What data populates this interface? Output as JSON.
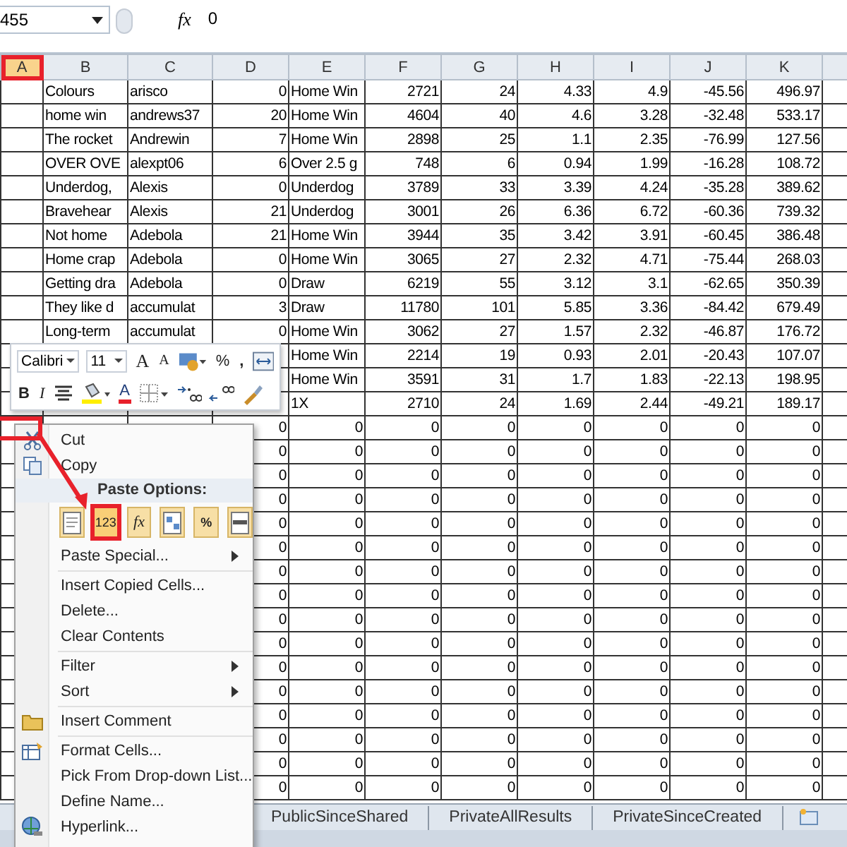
{
  "formula_bar": {
    "name_box": "455",
    "fx": "fx",
    "value": "0"
  },
  "columns": [
    {
      "label": "A",
      "selected": true
    },
    {
      "label": "B",
      "kind": "text",
      "selected": false
    },
    {
      "label": "C",
      "kind": "text",
      "selected": false
    },
    {
      "label": "D",
      "kind": "number",
      "selected": false
    },
    {
      "label": "E",
      "kind": "text",
      "selected": false
    },
    {
      "label": "F",
      "kind": "number",
      "selected": false
    },
    {
      "label": "G",
      "kind": "number",
      "selected": false
    },
    {
      "label": "H",
      "kind": "number",
      "selected": false
    },
    {
      "label": "I",
      "kind": "number",
      "selected": false
    },
    {
      "label": "J",
      "kind": "number",
      "selected": false
    },
    {
      "label": "K",
      "kind": "number",
      "selected": false
    }
  ],
  "rows": [
    {
      "kind": "data",
      "cells": [
        null,
        "Colours",
        "arisco",
        "0",
        "Home Win",
        "2721",
        "24",
        "4.33",
        "4.9",
        "-45.56",
        "496.97"
      ]
    },
    {
      "kind": "data",
      "cells": [
        null,
        "home win",
        "andrews37",
        "20",
        "Home Win",
        "4604",
        "40",
        "4.6",
        "3.28",
        "-32.48",
        "533.17"
      ]
    },
    {
      "kind": "data",
      "cells": [
        null,
        "The rocket",
        "Andrewin",
        "7",
        "Home Win",
        "2898",
        "25",
        "1.1",
        "2.35",
        "-76.99",
        "127.56"
      ]
    },
    {
      "kind": "data",
      "cells": [
        null,
        "OVER OVE",
        "alexpt06",
        "6",
        "Over 2.5 g",
        "748",
        "6",
        "0.94",
        "1.99",
        "-16.28",
        "108.72"
      ]
    },
    {
      "kind": "data",
      "cells": [
        null,
        "Underdog,",
        "Alexis",
        "0",
        "Underdog",
        "3789",
        "33",
        "3.39",
        "4.24",
        "-35.28",
        "389.62"
      ]
    },
    {
      "kind": "data",
      "cells": [
        null,
        "Bravehear",
        "Alexis",
        "21",
        "Underdog",
        "3001",
        "26",
        "6.36",
        "6.72",
        "-60.36",
        "739.32"
      ]
    },
    {
      "kind": "data",
      "cells": [
        null,
        "Not home",
        "Adebola",
        "21",
        "Home Win",
        "3944",
        "35",
        "3.42",
        "3.91",
        "-60.45",
        "386.48"
      ]
    },
    {
      "kind": "data",
      "cells": [
        null,
        "Home crap",
        "Adebola",
        "0",
        "Home Win",
        "3065",
        "27",
        "2.32",
        "4.71",
        "-75.44",
        "268.03"
      ]
    },
    {
      "kind": "data",
      "cells": [
        null,
        "Getting dra",
        "Adebola",
        "0",
        "Draw",
        "6219",
        "55",
        "3.12",
        "3.1",
        "-62.65",
        "350.39"
      ]
    },
    {
      "kind": "data",
      "cells": [
        null,
        "They like d",
        "accumulat",
        "3",
        "Draw",
        "11780",
        "101",
        "5.85",
        "3.36",
        "-84.42",
        "679.49"
      ]
    },
    {
      "kind": "data",
      "cells": [
        null,
        "Long-term",
        "accumulat",
        "0",
        "Home Win",
        "3062",
        "27",
        "1.57",
        "2.32",
        "-46.87",
        "176.72"
      ]
    },
    {
      "kind": "data",
      "cells": [
        null,
        null,
        null,
        null,
        "Home Win",
        "2214",
        "19",
        "0.93",
        "2.01",
        "-20.43",
        "107.07"
      ]
    },
    {
      "kind": "data",
      "cells": [
        null,
        null,
        null,
        null,
        "Home Win",
        "3591",
        "31",
        "1.7",
        "1.83",
        "-22.13",
        "198.95"
      ]
    },
    {
      "kind": "data",
      "cells": [
        null,
        null,
        null,
        null,
        "1X",
        "2710",
        "24",
        "1.69",
        "2.44",
        "-49.21",
        "189.17"
      ]
    },
    {
      "kind": "filler",
      "cells": [
        null,
        null,
        null,
        "0",
        "0",
        "0",
        "0",
        "0",
        "0",
        "0",
        "0"
      ]
    },
    {
      "kind": "filler",
      "cells": [
        null,
        null,
        null,
        "0",
        "0",
        "0",
        "0",
        "0",
        "0",
        "0",
        "0"
      ]
    },
    {
      "kind": "filler",
      "cells": [
        null,
        null,
        null,
        "0",
        "0",
        "0",
        "0",
        "0",
        "0",
        "0",
        "0"
      ]
    },
    {
      "kind": "filler",
      "cells": [
        null,
        null,
        null,
        "0",
        "0",
        "0",
        "0",
        "0",
        "0",
        "0",
        "0"
      ]
    },
    {
      "kind": "filler",
      "cells": [
        null,
        null,
        null,
        "0",
        "0",
        "0",
        "0",
        "0",
        "0",
        "0",
        "0"
      ]
    },
    {
      "kind": "filler",
      "cells": [
        null,
        null,
        null,
        "0",
        "0",
        "0",
        "0",
        "0",
        "0",
        "0",
        "0"
      ]
    },
    {
      "kind": "filler",
      "cells": [
        null,
        null,
        null,
        "0",
        "0",
        "0",
        "0",
        "0",
        "0",
        "0",
        "0"
      ]
    },
    {
      "kind": "filler",
      "cells": [
        null,
        null,
        null,
        "0",
        "0",
        "0",
        "0",
        "0",
        "0",
        "0",
        "0"
      ]
    },
    {
      "kind": "filler",
      "cells": [
        null,
        null,
        null,
        "0",
        "0",
        "0",
        "0",
        "0",
        "0",
        "0",
        "0"
      ]
    },
    {
      "kind": "filler",
      "cells": [
        null,
        null,
        null,
        "0",
        "0",
        "0",
        "0",
        "0",
        "0",
        "0",
        "0"
      ]
    },
    {
      "kind": "filler",
      "cells": [
        null,
        null,
        null,
        "0",
        "0",
        "0",
        "0",
        "0",
        "0",
        "0",
        "0"
      ]
    },
    {
      "kind": "filler",
      "cells": [
        null,
        null,
        null,
        "0",
        "0",
        "0",
        "0",
        "0",
        "0",
        "0",
        "0"
      ]
    },
    {
      "kind": "filler",
      "cells": [
        null,
        null,
        null,
        "0",
        "0",
        "0",
        "0",
        "0",
        "0",
        "0",
        "0"
      ]
    },
    {
      "kind": "filler",
      "cells": [
        null,
        null,
        null,
        "0",
        "0",
        "0",
        "0",
        "0",
        "0",
        "0",
        "0"
      ]
    },
    {
      "kind": "filler",
      "cells": [
        null,
        null,
        null,
        "0",
        "0",
        "0",
        "0",
        "0",
        "0",
        "0",
        "0"
      ]
    },
    {
      "kind": "filler",
      "cells": [
        null,
        null,
        null,
        "0",
        "0",
        "0",
        "0",
        "0",
        "0",
        "0",
        "0"
      ]
    }
  ],
  "mini_toolbar": {
    "font": "Calibri",
    "size": "11",
    "grow_font": "A",
    "shrink_font": "A",
    "percent": "%",
    "comma": ",",
    "bold": "B",
    "italic": "I",
    "font_color": "A"
  },
  "context_menu": [
    {
      "kind": "cut",
      "label": "Cut"
    },
    {
      "kind": "copy",
      "label": "Copy"
    },
    {
      "kind": "heading",
      "label": "Paste Options:"
    },
    {
      "kind": "paste_row",
      "options": [
        {
          "kind": "paste",
          "selected": false
        },
        {
          "kind": "values",
          "label": "123",
          "selected": true
        },
        {
          "kind": "formulas",
          "label": "fx",
          "selected": false
        },
        {
          "kind": "transpose",
          "selected": false
        },
        {
          "kind": "formatting",
          "label": "%",
          "selected": false
        },
        {
          "kind": "link",
          "selected": false
        }
      ]
    },
    {
      "kind": "submenu",
      "label": "Paste Special..."
    },
    {
      "kind": "separator"
    },
    {
      "kind": "command",
      "label": "Insert Copied Cells..."
    },
    {
      "kind": "command",
      "label": "Delete..."
    },
    {
      "kind": "command",
      "label": "Clear Contents"
    },
    {
      "kind": "separator"
    },
    {
      "kind": "submenu",
      "label": "Filter"
    },
    {
      "kind": "submenu",
      "label": "Sort"
    },
    {
      "kind": "separator"
    },
    {
      "kind": "comment",
      "label": "Insert Comment"
    },
    {
      "kind": "separator"
    },
    {
      "kind": "format",
      "label": "Format Cells..."
    },
    {
      "kind": "command",
      "label": "Pick From Drop-down List..."
    },
    {
      "kind": "command",
      "label": "Define Name..."
    },
    {
      "kind": "hyperlink",
      "label": "Hyperlink..."
    }
  ],
  "sheet_tabs": [
    {
      "label": "PublicSinceShared",
      "selected": false
    },
    {
      "label": "PrivateAllResults",
      "selected": false
    },
    {
      "label": "PrivateSinceCreated",
      "selected": false
    }
  ]
}
